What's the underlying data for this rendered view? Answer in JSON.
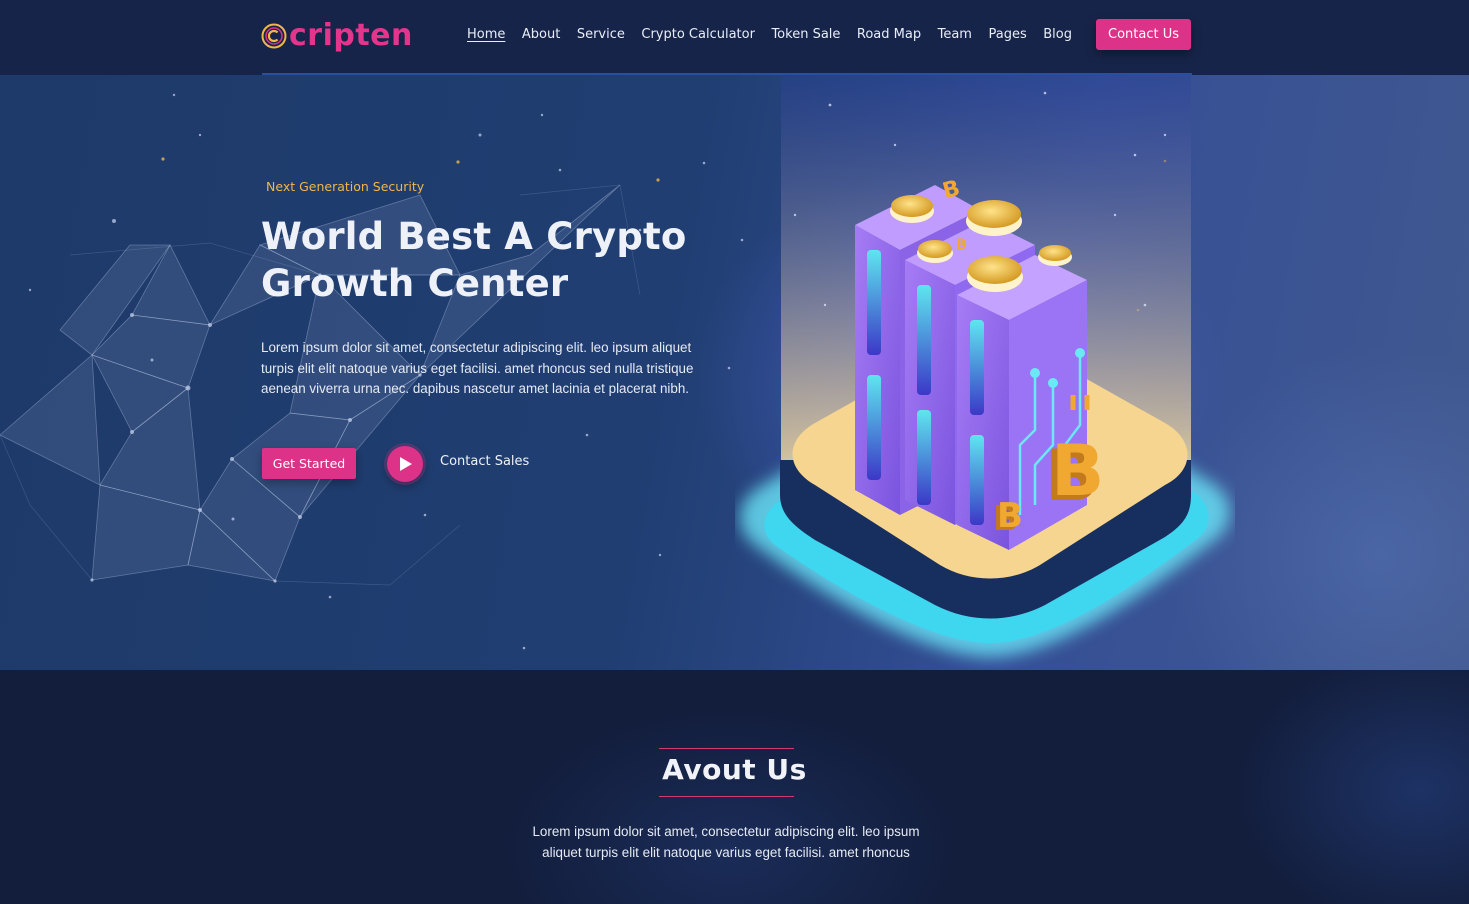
{
  "brand": {
    "name": "cripten",
    "logo_icon": "coin-c-icon",
    "primary_color": "#dc3287",
    "accent_color": "#f1b64a"
  },
  "nav": {
    "items": [
      {
        "label": "Home",
        "active": true
      },
      {
        "label": "About"
      },
      {
        "label": "Service"
      },
      {
        "label": "Crypto Calculator"
      },
      {
        "label": "Token Sale"
      },
      {
        "label": "Road Map"
      },
      {
        "label": "Team"
      },
      {
        "label": "Pages"
      },
      {
        "label": "Blog"
      }
    ],
    "cta_label": "Contact Us"
  },
  "hero": {
    "eyebrow": "Next Generation Security",
    "title": "World Best A Crypto Growth Center",
    "text": "Lorem ipsum dolor sit amet, consectetur adipiscing elit. leo ipsum aliquet turpis elit elit natoque varius eget facilisi. amet rhoncus sed nulla tristique aenean viverra urna nec. dapibus nascetur amet lacinia et placerat nibh.",
    "primary_button": "Get Started",
    "play_icon": "play-icon",
    "secondary_link": "Contact Sales",
    "illustration": "isometric-bitcoin-server-illustration"
  },
  "about": {
    "title": "Avout Us",
    "text": "Lorem ipsum dolor sit amet, consectetur adipiscing elit. leo ipsum aliquet turpis elit elit natoque varius eget facilisi. amet rhoncus"
  }
}
